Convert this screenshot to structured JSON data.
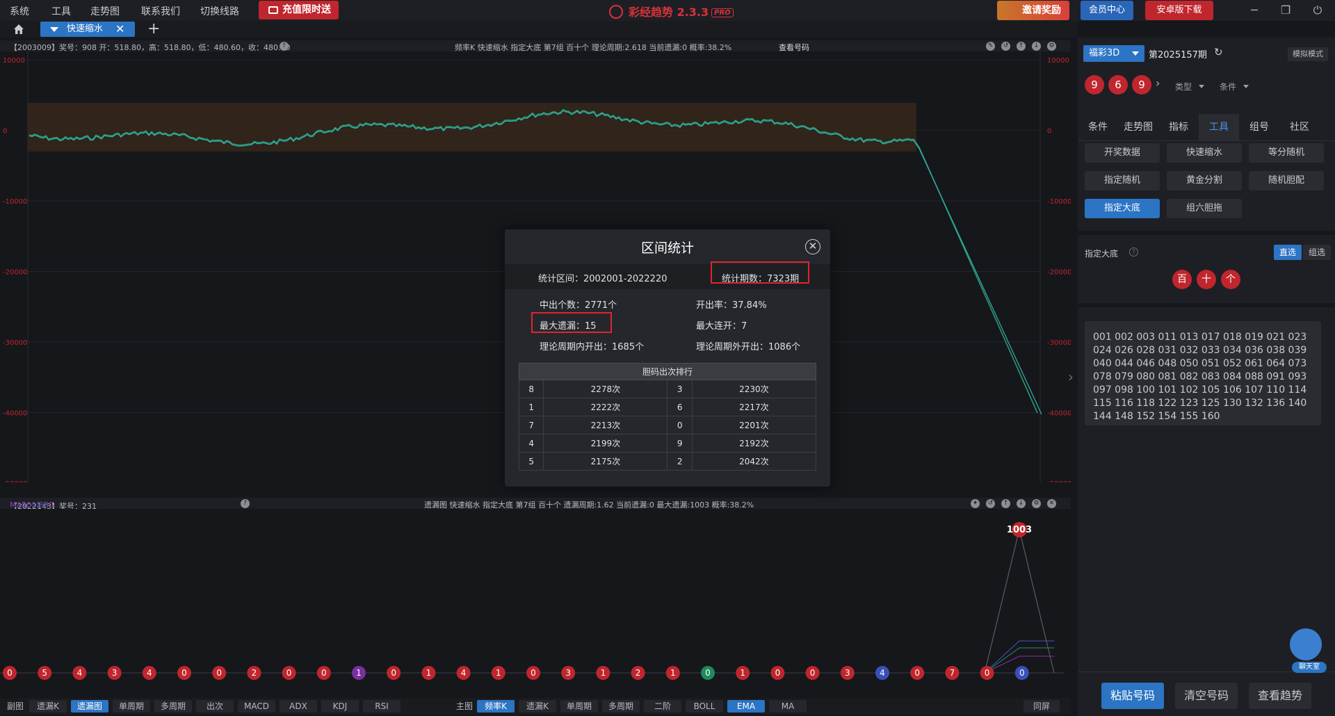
{
  "menu": {
    "items": [
      "系统",
      "工具",
      "走势图",
      "联系我们",
      "切换线路"
    ],
    "promo": "充值限时送",
    "app_title": "彩经趋势 2.3.3",
    "pro": "PRO",
    "invite": "邀请奖励",
    "vip": "会员中心",
    "android": "安卓版下载"
  },
  "tabs": {
    "active": "快速缩水",
    "close": "✕",
    "add": "+"
  },
  "main_header": {
    "left": "【2003009】奖号：908  开：518.80，高：518.80，低：480.60，收：480.60",
    "right": "频率K  快速缩水  指定大底 第7组  百十个  理论周期:2.618  当前遗漏:0  概率:38.2%",
    "link": "查看号码"
  },
  "main_axis": {
    "left": [
      "10000",
      "0",
      "-10000",
      "-20000",
      "-30000",
      "-40000",
      "-50000"
    ],
    "right": [
      "10000",
      "0",
      "-10000",
      "-20000",
      "-30000",
      "-40000",
      "-50000"
    ]
  },
  "sub_header": {
    "left_prefix": "【2022143】奖号：231 ",
    "ma5": "MA5: 2.80",
    "ma10": "MA10: 2.80",
    "ma20": "MA20: 3.30",
    "right": "遗漏图  快速缩水  指定大底 第7组  百十个  遗漏周期:1.62  当前遗漏:0  最大遗漏:1003  概率:38.2%"
  },
  "sub_chart": {
    "peak_label": "1003",
    "balls": [
      "0",
      "5",
      "4",
      "3",
      "4",
      "0",
      "0",
      "2",
      "0",
      "0",
      "1",
      "0",
      "1",
      "4",
      "1",
      "0",
      "3",
      "1",
      "2",
      "1",
      "0",
      "1",
      "0",
      "0",
      "3",
      "4",
      "0",
      "7",
      "0",
      "0"
    ],
    "ball_colors": [
      "#c0262d",
      "#c0262d",
      "#c0262d",
      "#c0262d",
      "#c0262d",
      "#c0262d",
      "#c0262d",
      "#c0262d",
      "#c0262d",
      "#c0262d",
      "#7b2fa0",
      "#c0262d",
      "#c0262d",
      "#c0262d",
      "#c0262d",
      "#c0262d",
      "#c0262d",
      "#c0262d",
      "#c0262d",
      "#c0262d",
      "#1f8a5a",
      "#c0262d",
      "#c0262d",
      "#c0262d",
      "#c0262d",
      "#3b4fb8",
      "#c0262d",
      "#c0262d",
      "#c0262d",
      "#3b4fb8"
    ]
  },
  "bottom_bar": {
    "sub_label": "副图",
    "sub": [
      "遗漏K",
      "遗漏图",
      "单周期",
      "多周期",
      "出次",
      "MACD",
      "ADX",
      "KDJ",
      "RSI"
    ],
    "main_label": "主图",
    "main": [
      "频率K",
      "遗漏K",
      "单周期",
      "多周期",
      "二阶",
      "BOLL",
      "EMA",
      "MA"
    ],
    "sync": "同屏"
  },
  "right": {
    "lottery": "福彩3D",
    "issue": "第2025157期",
    "mode": "模拟模式",
    "balls": [
      "9",
      "6",
      "9"
    ],
    "type": "类型",
    "cond": "条件",
    "tabs": [
      "条件",
      "走势图",
      "指标",
      "工具",
      "组号",
      "社区"
    ],
    "tools": [
      "开奖数据",
      "快速缩水",
      "等分随机",
      "指定随机",
      "黄金分割",
      "随机胆配",
      "指定大底",
      "组六胆拖"
    ],
    "section": "指定大底",
    "seg_direct": "直选",
    "seg_group": "组选",
    "digits": [
      "百",
      "十",
      "个"
    ],
    "numbers": "001 002 003 011 013 017 018 019 021 023 024 026 028 031 032 033 034 036 038 039 040 044 046 048 050 051 052 061 064 073 078 079 080 081 082 083 084 088 091 093 097 098 100 101 102 105 106 107 110 114 115 116 118 122 123 125 130 132 136 140 144 148 152 154 155 160",
    "paste": "粘贴号码",
    "clear": "清空号码",
    "view": "查看趋势",
    "chat": "聊天室"
  },
  "dialog": {
    "title": "区间统计",
    "range": "统计区间：2002001-2022220",
    "periods": "统计期数：7323期",
    "hits": "中出个数：2771个",
    "rate": "开出率：37.84%",
    "max_miss": "最大遗漏：15",
    "max_streak": "最大连开：7",
    "in_cycle": "理论周期内开出：1685个",
    "out_cycle": "理论周期外开出：1086个",
    "table_title": "胆码出次排行",
    "rows": [
      [
        "8",
        "2278次",
        "3",
        "2230次"
      ],
      [
        "1",
        "2222次",
        "6",
        "2217次"
      ],
      [
        "7",
        "2213次",
        "0",
        "2201次"
      ],
      [
        "4",
        "2199次",
        "9",
        "2192次"
      ],
      [
        "5",
        "2175次",
        "2",
        "2042次"
      ]
    ]
  }
}
